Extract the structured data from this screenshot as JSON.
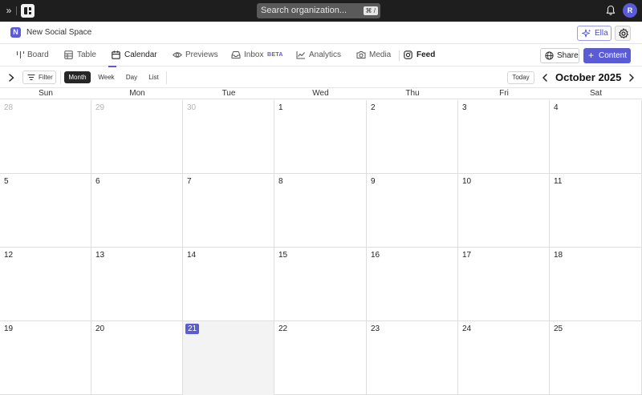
{
  "topbar": {
    "search_placeholder": "Search organization...",
    "search_shortcut": "⌘ /",
    "avatar_initial": "R"
  },
  "space": {
    "icon_letter": "N",
    "name": "New Social Space",
    "ella_label": "Ella"
  },
  "tabs": {
    "board": "Board",
    "table": "Table",
    "calendar": "Calendar",
    "previews": "Previews",
    "inbox": "Inbox",
    "inbox_badge": "BETA",
    "analytics": "Analytics",
    "media": "Media",
    "feed": "Feed",
    "active": "calendar"
  },
  "actions": {
    "share": "Share",
    "content": "Content"
  },
  "toolbar": {
    "filter": "Filter",
    "views": [
      "Month",
      "Week",
      "Day",
      "List"
    ],
    "active_view": "Month",
    "today": "Today",
    "month_title": "October 2025"
  },
  "calendar": {
    "weekdays": [
      "Sun",
      "Mon",
      "Tue",
      "Wed",
      "Thu",
      "Fri",
      "Sat"
    ],
    "weeks": [
      [
        "28",
        "29",
        "30",
        "1",
        "2",
        "3",
        "4"
      ],
      [
        "5",
        "6",
        "7",
        "8",
        "9",
        "10",
        "11"
      ],
      [
        "12",
        "13",
        "14",
        "15",
        "16",
        "17",
        "18"
      ],
      [
        "19",
        "20",
        "21",
        "22",
        "23",
        "24",
        "25"
      ]
    ],
    "other_month_days": [
      "28",
      "29",
      "30"
    ],
    "today": "21"
  },
  "colors": {
    "accent": "#5b5bd6",
    "topbar_bg": "#1e1e1e",
    "today_cell_bg": "#f3f3f3"
  }
}
